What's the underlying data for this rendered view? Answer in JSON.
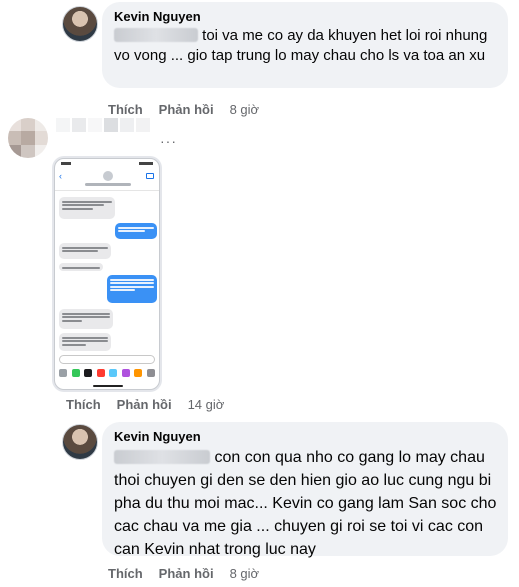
{
  "comment1": {
    "author": "Kevin Nguyen",
    "text": "toi va me co ay da khuyen het loi roi nhung vo vong ... gio tap trung lo may chau cho ls va toa an xu",
    "actions": {
      "like": "Thích",
      "reply": "Phản hồi",
      "time": "8 giờ"
    }
  },
  "comment2": {
    "attachment": "blurred-message-screenshot",
    "more": "···",
    "actions": {
      "like": "Thích",
      "reply": "Phản hồi",
      "time": "14 giờ"
    }
  },
  "comment3": {
    "author": "Kevin Nguyen",
    "text": "con con qua nho co gang lo may chau thoi chuyen gi den se den hien gio ao luc cung ngu bi pha du thu moi mac... Kevin co gang lam San soc cho cac chau va me gia ... chuyen gi roi se toi vi cac con can Kevin nhat trong luc nay",
    "actions": {
      "like": "Thích",
      "reply": "Phản hồi",
      "time": "8 giờ"
    }
  },
  "colors": {
    "bubble": "#f0f2f5",
    "meta": "#65676b",
    "imessage_blue": "#3a91f5"
  }
}
